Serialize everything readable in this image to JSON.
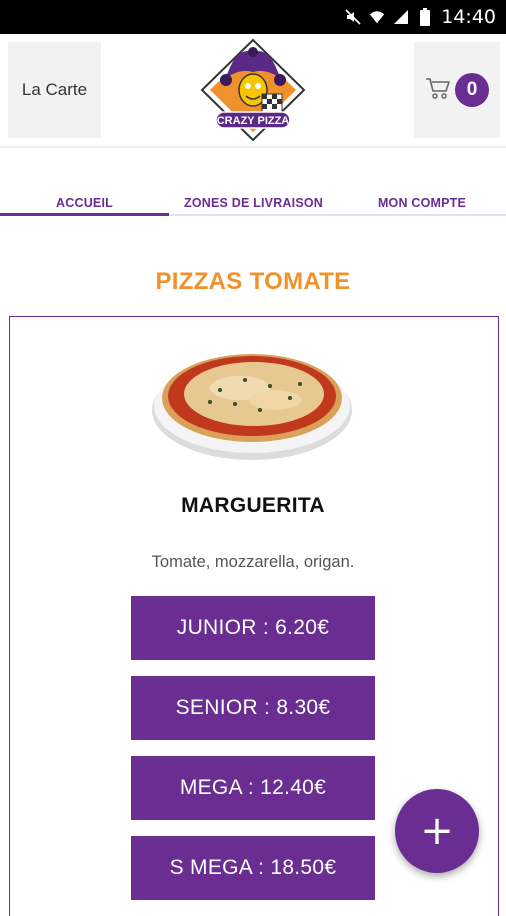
{
  "status_bar": {
    "time": "14:40",
    "icons": [
      "mute-icon",
      "wifi-icon",
      "signal-icon",
      "battery-icon"
    ]
  },
  "header": {
    "menu_label": "La Carte",
    "logo_text": "CRAZY PIZZA",
    "cart_count": "0",
    "cart_icon": "cart-icon"
  },
  "tabs": [
    {
      "label": "ACCUEIL",
      "active": true
    },
    {
      "label": "ZONES DE LIVRAISON",
      "active": false
    },
    {
      "label": "MON COMPTE",
      "active": false
    }
  ],
  "section": {
    "title": "PIZZAS TOMATE"
  },
  "product": {
    "name": "MARGUERITA",
    "description": "Tomate, mozzarella, origan.",
    "prices": [
      {
        "label": "JUNIOR : 6.20€"
      },
      {
        "label": "SENIOR : 8.30€"
      },
      {
        "label": "MEGA : 12.40€"
      },
      {
        "label": "S MEGA : 18.50€"
      }
    ]
  },
  "fab": {
    "label": "+"
  },
  "colors": {
    "primary": "#6a2d91",
    "accent": "#f0922c"
  }
}
